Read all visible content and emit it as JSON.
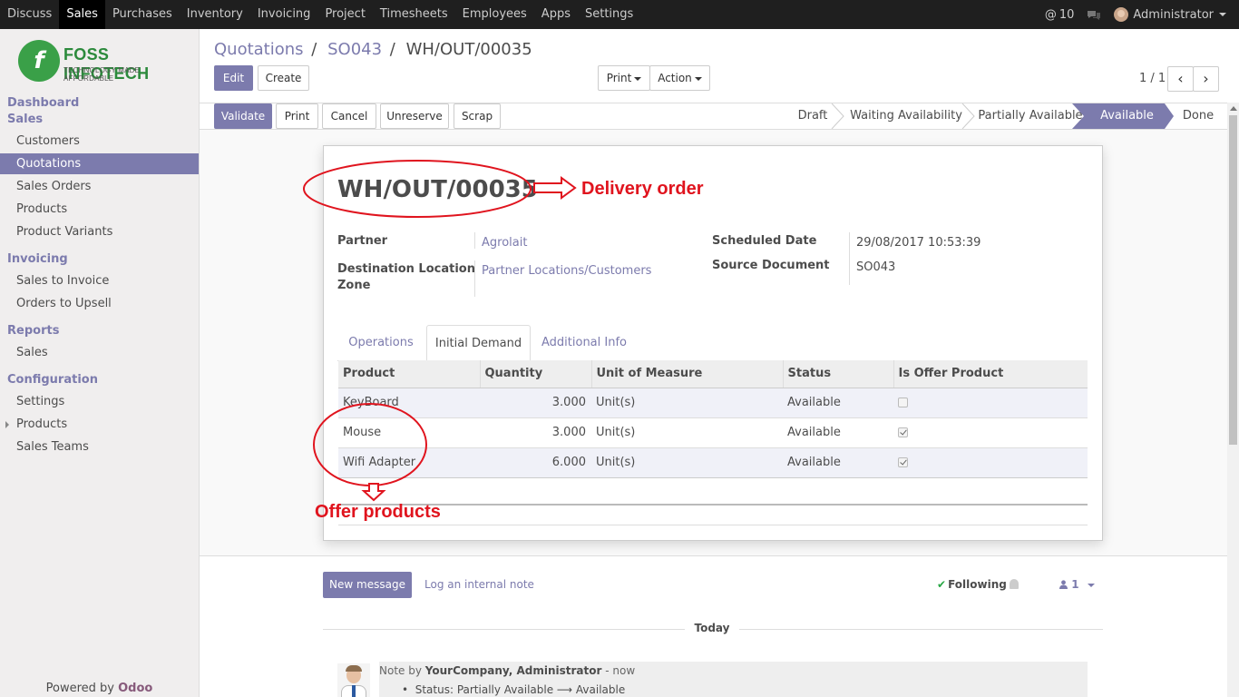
{
  "topbar": {
    "menu": [
      "Discuss",
      "Sales",
      "Purchases",
      "Inventory",
      "Invoicing",
      "Project",
      "Timesheets",
      "Employees",
      "Apps",
      "Settings"
    ],
    "active": "Sales",
    "mentions_icon": "@",
    "mentions_count": "10",
    "user": "Administrator"
  },
  "logo": {
    "brand": "FOSS INFOTECH",
    "tagline": "TECHNOLOGY MADE AFFORDABLE"
  },
  "sidebar": {
    "dashboard": "Dashboard",
    "sales_head": "Sales",
    "sales_items": [
      "Customers",
      "Quotations",
      "Sales Orders",
      "Products",
      "Product Variants"
    ],
    "invoicing_head": "Invoicing",
    "invoicing_items": [
      "Sales to Invoice",
      "Orders to Upsell"
    ],
    "reports_head": "Reports",
    "reports_items": [
      "Sales"
    ],
    "config_head": "Configuration",
    "config_items": [
      "Settings",
      "Products",
      "Sales Teams"
    ],
    "powered_prefix": "Powered by ",
    "powered_brand": "Odoo"
  },
  "breadcrumb": {
    "b1": "Quotations",
    "b2": "SO043",
    "current": "WH/OUT/00035",
    "sep": "/"
  },
  "buttons": {
    "edit": "Edit",
    "create": "Create",
    "print": "Print",
    "action": "Action",
    "validate": "Validate",
    "print2": "Print",
    "cancel": "Cancel",
    "unreserve": "Unreserve",
    "scrap": "Scrap"
  },
  "pager": {
    "value": "1 / 1",
    "prev": "‹",
    "next": "›"
  },
  "stages": [
    "Draft",
    "Waiting Availability",
    "Partially Available",
    "Available",
    "Done"
  ],
  "current_stage": "Available",
  "record": {
    "name": "WH/OUT/00035",
    "partner_label": "Partner",
    "partner": "Agrolait",
    "dest_label": "Destination Location",
    "dest_label2": "Zone",
    "dest": "Partner Locations/Customers",
    "sched_label": "Scheduled Date",
    "sched": "29/08/2017 10:53:39",
    "source_label": "Source Document",
    "source": "SO043"
  },
  "tabs": [
    "Operations",
    "Initial Demand",
    "Additional Info"
  ],
  "table": {
    "headers": [
      "Product",
      "Quantity",
      "Unit of Measure",
      "Status",
      "Is Offer Product"
    ],
    "rows": [
      {
        "product": "KeyBoard",
        "qty": "3.000",
        "uom": "Unit(s)",
        "status": "Available",
        "offer": false
      },
      {
        "product": "Mouse",
        "qty": "3.000",
        "uom": "Unit(s)",
        "status": "Available",
        "offer": true
      },
      {
        "product": "Wifi Adapter",
        "qty": "6.000",
        "uom": "Unit(s)",
        "status": "Available",
        "offer": true
      }
    ]
  },
  "annotations": {
    "delivery": "Delivery order",
    "offer": "Offer products",
    "color": "#e0141e"
  },
  "chatter": {
    "new_message": "New message",
    "log_note": "Log an internal note",
    "following": "Following",
    "followers": "1",
    "today": "Today",
    "note_prefix": "Note by",
    "author": "YourCompany, Administrator",
    "time": "- now",
    "status_line": "Status: Partially Available ⟶ Available"
  },
  "colors": {
    "accent": "#7c7bad",
    "topbar": "#1f1f1f",
    "sidebar": "#f0eeee"
  }
}
